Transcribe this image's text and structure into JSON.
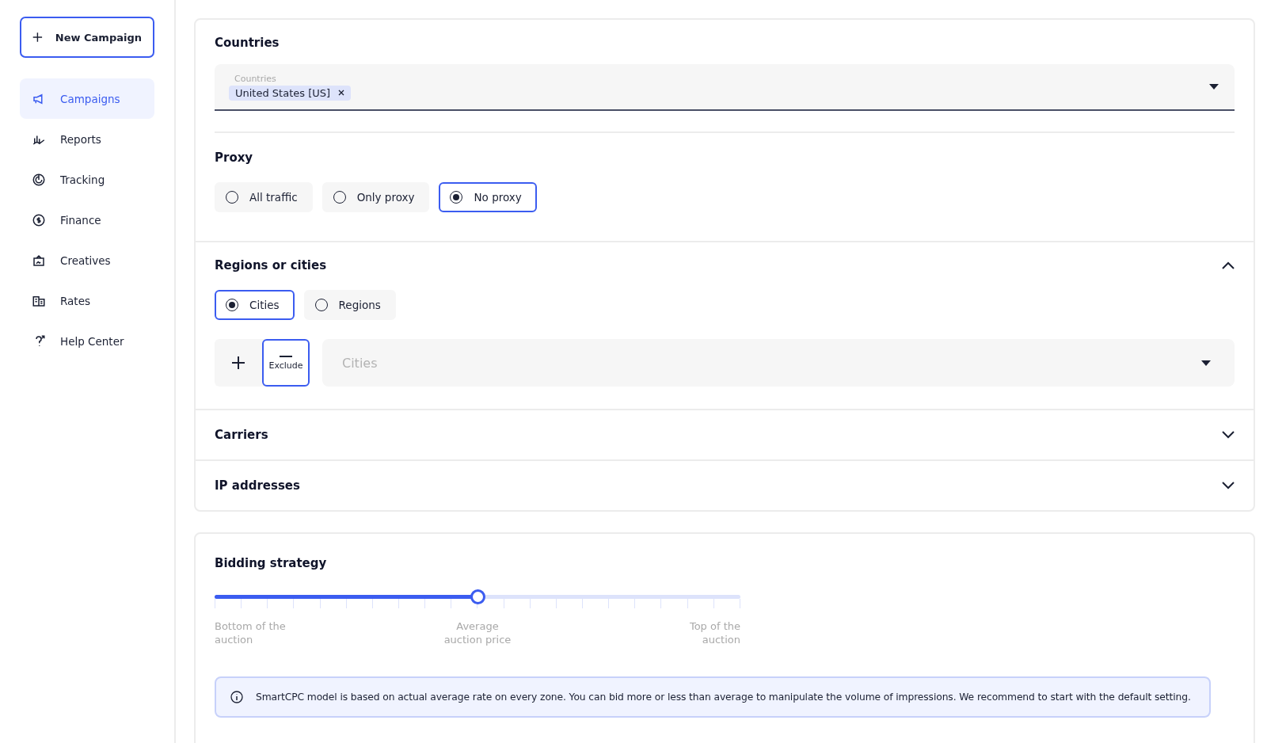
{
  "sidebar": {
    "new_button": "New Campaign",
    "items": [
      {
        "kind": "campaigns",
        "label": "Campaigns",
        "selected": true
      },
      {
        "kind": "reports",
        "label": "Reports",
        "selected": false
      },
      {
        "kind": "tracking",
        "label": "Tracking",
        "selected": false
      },
      {
        "kind": "finance",
        "label": "Finance",
        "selected": false
      },
      {
        "kind": "creatives",
        "label": "Creatives",
        "selected": false
      },
      {
        "kind": "rates",
        "label": "Rates",
        "selected": false
      },
      {
        "kind": "help",
        "label": "Help Center",
        "selected": false
      }
    ]
  },
  "countries": {
    "title": "Countries",
    "field_label": "Countries",
    "tags": [
      "United States [US]"
    ]
  },
  "proxy": {
    "title": "Proxy",
    "options": [
      {
        "label": "All traffic",
        "selected": false
      },
      {
        "label": "Only proxy",
        "selected": false
      },
      {
        "label": "No proxy",
        "selected": true
      }
    ]
  },
  "regions": {
    "title": "Regions or cities",
    "expanded": true,
    "options": [
      {
        "label": "Cities",
        "selected": true
      },
      {
        "label": "Regions",
        "selected": false
      }
    ],
    "modes": [
      {
        "kind": "include",
        "selected": false
      },
      {
        "kind": "exclude",
        "label": "Exclude",
        "selected": true
      }
    ],
    "placeholder": "Cities"
  },
  "collapsed_sections": [
    {
      "title": "Carriers",
      "expanded": false
    },
    {
      "title": "IP addresses",
      "expanded": false
    }
  ],
  "bidding": {
    "title": "Bidding strategy",
    "level": 0.5,
    "labels": [
      "Bottom of the auction",
      "Average auction price",
      "Top of the auction"
    ],
    "info": "SmartCPC model is based on actual average rate on every zone. You can bid more or less than average to manipulate the volume of impressions. We recommend to start with the default setting."
  }
}
